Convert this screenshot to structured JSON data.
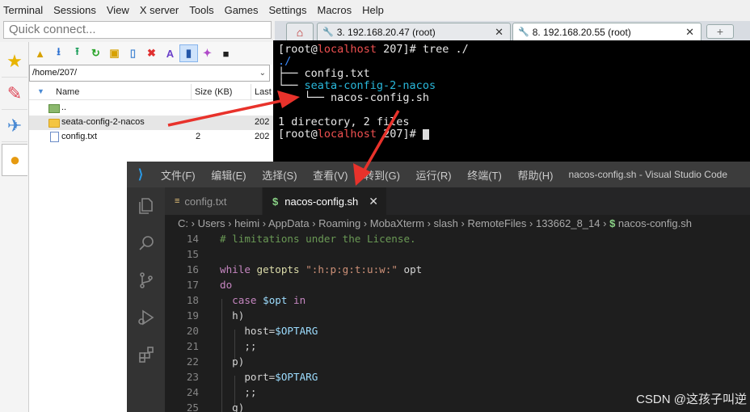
{
  "menu": [
    "Terminal",
    "Sessions",
    "View",
    "X server",
    "Tools",
    "Games",
    "Settings",
    "Macros",
    "Help"
  ],
  "quick_connect": {
    "placeholder": "Quick connect..."
  },
  "session_tabs": [
    {
      "label": "3. 192.168.20.47 (root)",
      "active": false
    },
    {
      "label": "8. 192.168.20.55 (root)",
      "active": true
    }
  ],
  "sftp": {
    "path": "/home/207/",
    "columns": {
      "name": "Name",
      "size": "Size (KB)",
      "last": "Last"
    },
    "files": [
      {
        "name": "..",
        "size": "",
        "modified": "",
        "type": "up"
      },
      {
        "name": "seata-config-2-nacos",
        "size": "",
        "modified": "202",
        "type": "folder",
        "selected": true
      },
      {
        "name": "config.txt",
        "size": "2",
        "modified": "202",
        "type": "file"
      }
    ]
  },
  "terminal": {
    "prompt_user": "root",
    "prompt_host": "localhost",
    "prompt_dir": "207",
    "command": "tree ./",
    "tree_root": "./",
    "entry1": "config.txt",
    "entry2": "seata-config-2-nacos",
    "entry3": "nacos-config.sh",
    "summary": "1 directory, 2 files"
  },
  "vscode": {
    "menu": [
      "文件(F)",
      "编辑(E)",
      "选择(S)",
      "查看(V)",
      "转到(G)",
      "运行(R)",
      "终端(T)",
      "帮助(H)"
    ],
    "window_title": "nacos-config.sh - Visual Studio Code",
    "tabs": [
      {
        "label": "config.txt",
        "active": false
      },
      {
        "label": "nacos-config.sh",
        "active": true
      }
    ],
    "breadcrumb": [
      "C:",
      "Users",
      "heimi",
      "AppData",
      "Roaming",
      "MobaXterm",
      "slash",
      "RemoteFiles",
      "133662_8_14",
      "nacos-config.sh"
    ],
    "code": [
      {
        "n": "14",
        "text": "# limitations under the License."
      },
      {
        "n": "15",
        "text": ""
      },
      {
        "n": "16",
        "text": "while getopts \":h:p:g:t:u:w:\" opt"
      },
      {
        "n": "17",
        "text": "do"
      },
      {
        "n": "18",
        "text": "  case $opt in"
      },
      {
        "n": "19",
        "text": "  h)"
      },
      {
        "n": "20",
        "text": "    host=$OPTARG"
      },
      {
        "n": "21",
        "text": "    ;;"
      },
      {
        "n": "22",
        "text": "  p)"
      },
      {
        "n": "23",
        "text": "    port=$OPTARG"
      },
      {
        "n": "24",
        "text": "    ;;"
      },
      {
        "n": "25",
        "text": "  g)"
      }
    ]
  },
  "watermark": "CSDN @这孩子叫逆"
}
